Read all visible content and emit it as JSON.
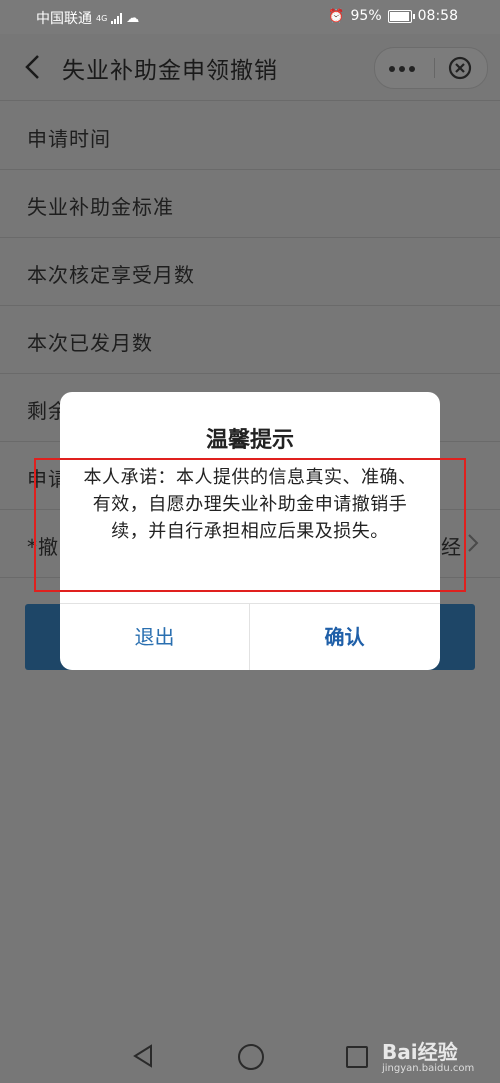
{
  "status_bar": {
    "carrier": "中国联通",
    "network": "4G",
    "battery": "95%",
    "time": "08:58"
  },
  "nav": {
    "title": "失业补助金申领撤销"
  },
  "list": {
    "rows": [
      {
        "label": "申请时间"
      },
      {
        "label": "失业补助金标准"
      },
      {
        "label": "本次核定享受月数"
      },
      {
        "label": "本次已发月数"
      },
      {
        "label": "剩余"
      },
      {
        "label": "申请"
      },
      {
        "label": "*撤",
        "tail": "经"
      }
    ]
  },
  "dialog": {
    "title": "温馨提示",
    "body": "本人承诺：本人提供的信息真实、准确、有效，自愿办理失业补助金申请撤销手续，并自行承担相应后果及损失。",
    "cancel_label": "退出",
    "confirm_label": "确认"
  },
  "watermark": {
    "brand": "Bai经验",
    "domain": "jingyan.baidu.com"
  },
  "colors": {
    "overlay_bg": "#777777",
    "dialog_bg": "#ffffff",
    "button_blue": "#2a6fb0",
    "highlight_red": "#e0201e",
    "submit_btn": "#1e4667"
  }
}
